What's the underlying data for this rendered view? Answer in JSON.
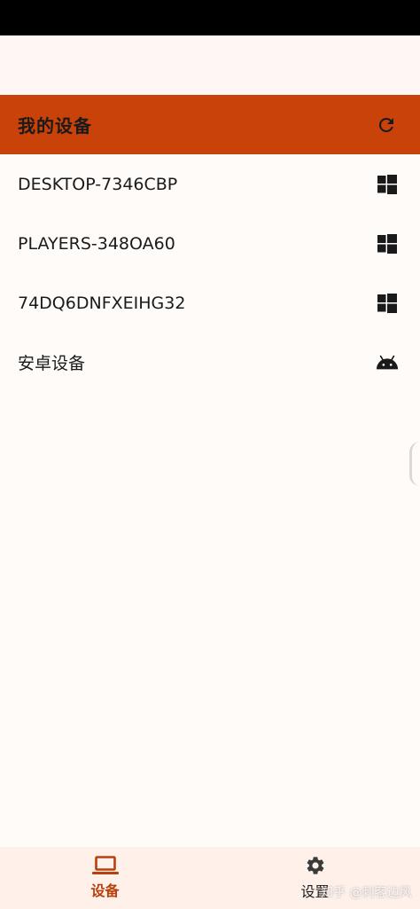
{
  "app_bar": {
    "title": "我的设备",
    "refresh_icon": "refresh-icon"
  },
  "devices": [
    {
      "name": "DESKTOP-7346CBP",
      "os_icon": "windows-icon"
    },
    {
      "name": "PLAYERS-348OA60",
      "os_icon": "windows-icon"
    },
    {
      "name": "74DQ6DNFXEIHG32",
      "os_icon": "windows-icon"
    },
    {
      "name": "安卓设备",
      "os_icon": "android-icon"
    }
  ],
  "bottom_nav": {
    "items": [
      {
        "label": "设备",
        "icon": "laptop-icon",
        "active": true
      },
      {
        "label": "设置",
        "icon": "gear-icon",
        "active": false
      }
    ]
  },
  "watermark": "知乎 @刺客边风",
  "colors": {
    "app_bar": "#c94209",
    "accent": "#b8400c",
    "background": "#fffbf9",
    "nav_background": "#fff0ea"
  }
}
